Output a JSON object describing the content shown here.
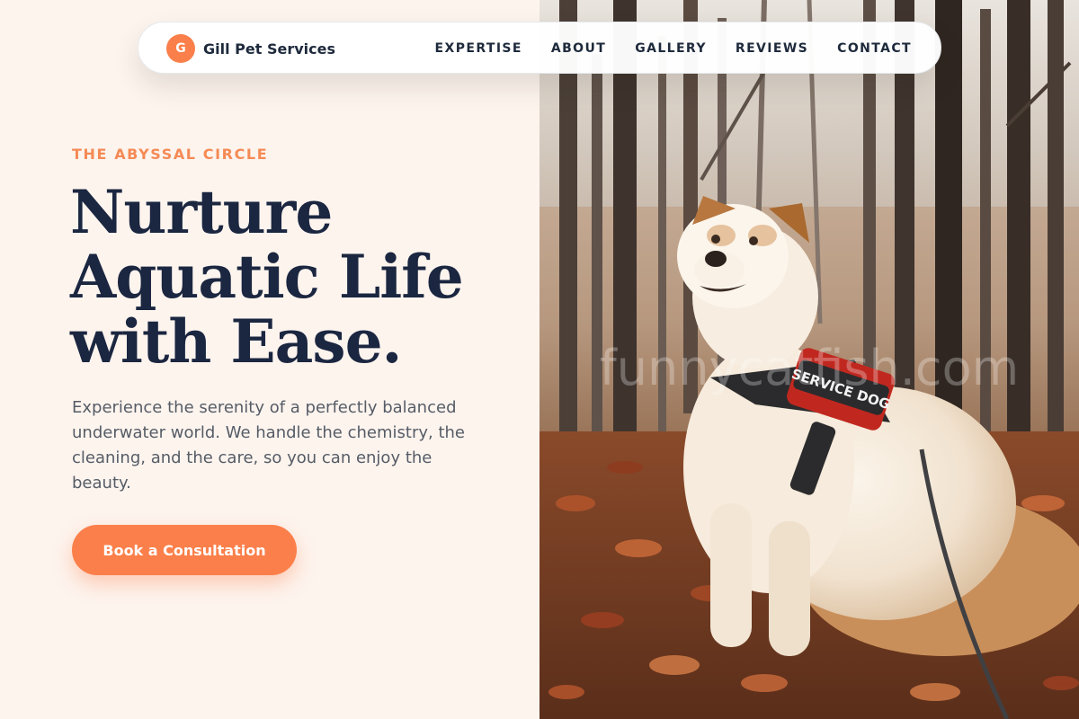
{
  "nav": {
    "brand_initial": "G",
    "brand_name": "Gill Pet Services",
    "links": [
      "EXPERTISE",
      "ABOUT",
      "GALLERY",
      "REVIEWS",
      "CONTACT"
    ]
  },
  "hero": {
    "eyebrow": "THE ABYSSAL CIRCLE",
    "headline_lines": [
      "Nurture",
      "Aquatic Life",
      "with Ease."
    ],
    "description": "Experience the serenity of a perfectly balanced underwater world. We handle the chemistry, the cleaning, and the care, so you can enjoy the beauty.",
    "cta_label": "Book a Consultation"
  },
  "photo": {
    "harness_text": "SERVICE DOG",
    "watermark": "funnycatfish.com"
  },
  "colors": {
    "accent": "#fb7f4a",
    "background": "#fdf4ee",
    "heading": "#1b2640",
    "body_text": "#555c66"
  }
}
